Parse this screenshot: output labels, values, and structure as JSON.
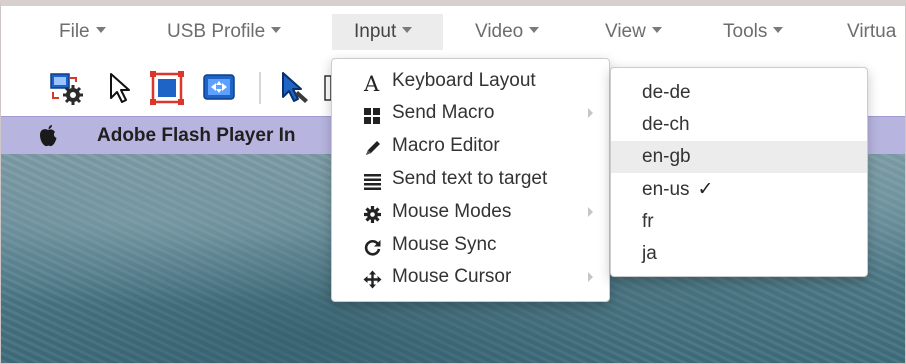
{
  "menubar": {
    "items": [
      {
        "label": "File"
      },
      {
        "label": "USB Profile"
      },
      {
        "label": "Input"
      },
      {
        "label": "Video"
      },
      {
        "label": "View"
      },
      {
        "label": "Tools"
      },
      {
        "label": "Virtua"
      }
    ]
  },
  "titlebar": {
    "title": "Adobe Flash Player In"
  },
  "input_menu": {
    "items": [
      {
        "label": "Keyboard Layout",
        "icon": "letter-a-icon"
      },
      {
        "label": "Send Macro",
        "icon": "grid-icon",
        "submenu": true
      },
      {
        "label": "Macro Editor",
        "icon": "pencil-icon"
      },
      {
        "label": "Send text to target",
        "icon": "list-lines-icon"
      },
      {
        "label": "Mouse Modes",
        "icon": "gear-icon",
        "submenu": true
      },
      {
        "label": "Mouse Sync",
        "icon": "refresh-icon"
      },
      {
        "label": "Mouse Cursor",
        "icon": "move-arrows-icon",
        "submenu": true
      }
    ]
  },
  "keyboard_layout_menu": {
    "items": [
      {
        "label": "de-de"
      },
      {
        "label": "de-ch"
      },
      {
        "label": "en-gb",
        "highlighted": true
      },
      {
        "label": "en-us",
        "checked": true,
        "check_mark": "✓"
      },
      {
        "label": "fr"
      },
      {
        "label": "ja"
      }
    ]
  },
  "colors": {
    "title_strip": "#b7b5e0",
    "menu_highlight": "#ececec",
    "icon_blue": "#1e63c6",
    "icon_red": "#d9372a"
  }
}
